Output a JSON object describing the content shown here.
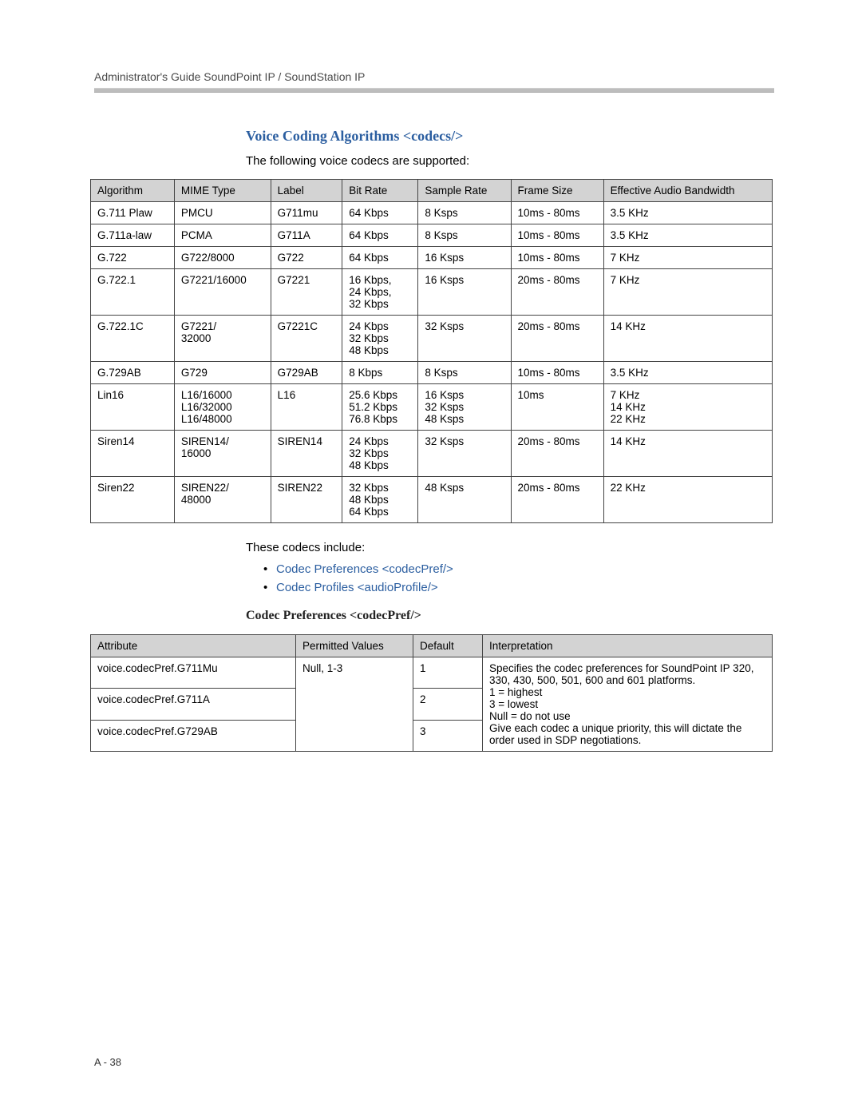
{
  "header": "Administrator's Guide SoundPoint IP / SoundStation IP",
  "section_title": "Voice Coding Algorithms <codecs/>",
  "intro": "The following voice codecs are supported:",
  "codec_table": {
    "headers": [
      "Algorithm",
      "MIME Type",
      "Label",
      "Bit Rate",
      "Sample Rate",
      "Frame Size",
      "Effective Audio Bandwidth"
    ],
    "rows": [
      [
        "G.711 Plaw",
        "PMCU",
        "G711mu",
        "64 Kbps",
        "8 Ksps",
        "10ms - 80ms",
        "3.5 KHz"
      ],
      [
        "G.711a-law",
        "PCMA",
        "G711A",
        "64 Kbps",
        "8 Ksps",
        "10ms - 80ms",
        "3.5 KHz"
      ],
      [
        "G.722",
        "G722/8000",
        "G722",
        "64 Kbps",
        "16 Ksps",
        "10ms - 80ms",
        "7 KHz"
      ],
      [
        "G.722.1",
        "G7221/16000",
        "G7221",
        "16 Kbps,\n24 Kbps,\n32 Kbps",
        "16 Ksps",
        "20ms - 80ms",
        "7 KHz"
      ],
      [
        "G.722.1C",
        "G7221/\n32000",
        "G7221C",
        "24 Kbps\n32 Kbps\n48 Kbps",
        "32 Ksps",
        "20ms - 80ms",
        "14 KHz"
      ],
      [
        "G.729AB",
        "G729",
        "G729AB",
        "8 Kbps",
        "8 Ksps",
        "10ms - 80ms",
        "3.5 KHz"
      ],
      [
        "Lin16",
        "L16/16000\nL16/32000\nL16/48000",
        "L16",
        "25.6 Kbps\n51.2 Kbps\n76.8 Kbps",
        "16 Ksps\n32 Ksps\n48 Ksps",
        "10ms",
        "7 KHz\n14 KHz\n22 KHz"
      ],
      [
        "Siren14",
        "SIREN14/\n16000",
        "SIREN14",
        "24 Kbps\n32 Kbps\n48 Kbps",
        "32 Ksps",
        "20ms - 80ms",
        "14 KHz"
      ],
      [
        "Siren22",
        "SIREN22/\n48000",
        "SIREN22",
        "32 Kbps\n48 Kbps\n64 Kbps",
        "48 Ksps",
        "20ms - 80ms",
        "22 KHz"
      ]
    ]
  },
  "mid_text": "These codecs include:",
  "links": [
    "Codec Preferences <codecPref/>",
    "Codec Profiles <audioProfile/>"
  ],
  "subhead": "Codec Preferences <codecPref/>",
  "pref_table": {
    "headers": [
      "Attribute",
      "Permitted Values",
      "Default",
      "Interpretation"
    ],
    "attrs": [
      {
        "name": "voice.codecPref.G711Mu",
        "default": "1"
      },
      {
        "name": "voice.codecPref.G711A",
        "default": "2"
      },
      {
        "name": "voice.codecPref.G729AB",
        "default": "3"
      }
    ],
    "permitted": "Null, 1-3",
    "interpretation": "Specifies the codec preferences for SoundPoint IP 320, 330, 430, 500, 501, 600 and 601 platforms.\n1 = highest\n3 = lowest\nNull = do not use\nGive each codec a unique priority, this will dictate the order used in SDP negotiations."
  },
  "footer": "A - 38"
}
